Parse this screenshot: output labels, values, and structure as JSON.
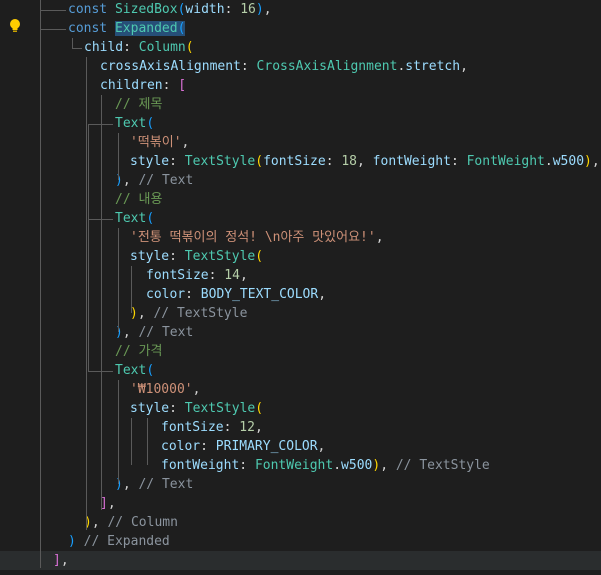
{
  "editor": {
    "lines": [
      {
        "segments": [
          {
            "t": "const",
            "c": "kw"
          },
          {
            "t": " "
          },
          {
            "t": "SizedBox",
            "c": "cls"
          },
          {
            "t": "(",
            "c": "b3"
          },
          {
            "t": "width",
            "c": "prop"
          },
          {
            "t": ": "
          },
          {
            "t": "16",
            "c": "num"
          },
          {
            "t": ")",
            "c": "b3"
          },
          {
            "t": ","
          }
        ]
      },
      {
        "segments": [
          {
            "t": "const",
            "c": "kw"
          },
          {
            "t": " "
          },
          {
            "t": "Expanded",
            "c": "cls hl"
          },
          {
            "t": "(",
            "c": "b3 hl"
          }
        ]
      },
      {
        "segments": [
          {
            "t": "child",
            "c": "prop"
          },
          {
            "t": ": "
          },
          {
            "t": "Column",
            "c": "cls"
          },
          {
            "t": "(",
            "c": "b1"
          }
        ]
      },
      {
        "segments": [
          {
            "t": "crossAxisAlignment",
            "c": "prop"
          },
          {
            "t": ": "
          },
          {
            "t": "CrossAxisAlignment",
            "c": "cls"
          },
          {
            "t": "."
          },
          {
            "t": "stretch",
            "c": "prop"
          },
          {
            "t": ","
          }
        ]
      },
      {
        "segments": [
          {
            "t": "children",
            "c": "prop"
          },
          {
            "t": ": "
          },
          {
            "t": "[",
            "c": "b2"
          }
        ]
      },
      {
        "segments": [
          {
            "t": "// 제목",
            "c": "cmt"
          }
        ]
      },
      {
        "segments": [
          {
            "t": "Text",
            "c": "cls"
          },
          {
            "t": "(",
            "c": "b3"
          }
        ]
      },
      {
        "segments": [
          {
            "t": "'떡볶이'",
            "c": "str"
          },
          {
            "t": ","
          }
        ]
      },
      {
        "segments": [
          {
            "t": "style",
            "c": "prop"
          },
          {
            "t": ": "
          },
          {
            "t": "TextStyle",
            "c": "cls"
          },
          {
            "t": "(",
            "c": "b1"
          },
          {
            "t": "fontSize",
            "c": "prop"
          },
          {
            "t": ": "
          },
          {
            "t": "18",
            "c": "num"
          },
          {
            "t": ", "
          },
          {
            "t": "fontWeight",
            "c": "prop"
          },
          {
            "t": ": "
          },
          {
            "t": "FontWeight",
            "c": "cls"
          },
          {
            "t": "."
          },
          {
            "t": "w500",
            "c": "prop"
          },
          {
            "t": ")",
            "c": "b1"
          },
          {
            "t": ","
          }
        ]
      },
      {
        "segments": [
          {
            "t": ")",
            "c": "b3"
          },
          {
            "t": ", "
          },
          {
            "t": "// Text",
            "c": "hint"
          }
        ]
      },
      {
        "segments": [
          {
            "t": "// 내용",
            "c": "cmt"
          }
        ]
      },
      {
        "segments": [
          {
            "t": "Text",
            "c": "cls"
          },
          {
            "t": "(",
            "c": "b3"
          }
        ]
      },
      {
        "segments": [
          {
            "t": "'전통 떡볶이의 정석! \\n아주 맛있어요!'",
            "c": "str"
          },
          {
            "t": ","
          }
        ]
      },
      {
        "segments": [
          {
            "t": "style",
            "c": "prop"
          },
          {
            "t": ": "
          },
          {
            "t": "TextStyle",
            "c": "cls"
          },
          {
            "t": "(",
            "c": "b1"
          }
        ]
      },
      {
        "segments": [
          {
            "t": "fontSize",
            "c": "prop"
          },
          {
            "t": ": "
          },
          {
            "t": "14",
            "c": "num"
          },
          {
            "t": ","
          }
        ]
      },
      {
        "segments": [
          {
            "t": "color",
            "c": "prop"
          },
          {
            "t": ": "
          },
          {
            "t": "BODY_TEXT_COLOR",
            "c": "prop"
          },
          {
            "t": ","
          }
        ]
      },
      {
        "segments": [
          {
            "t": ")",
            "c": "b1"
          },
          {
            "t": ", "
          },
          {
            "t": "// TextStyle",
            "c": "hint"
          }
        ]
      },
      {
        "segments": [
          {
            "t": ")",
            "c": "b3"
          },
          {
            "t": ", "
          },
          {
            "t": "// Text",
            "c": "hint"
          }
        ]
      },
      {
        "segments": [
          {
            "t": "// 가격",
            "c": "cmt"
          }
        ]
      },
      {
        "segments": [
          {
            "t": "Text",
            "c": "cls"
          },
          {
            "t": "(",
            "c": "b3"
          }
        ]
      },
      {
        "segments": [
          {
            "t": "'₩10000'",
            "c": "str"
          },
          {
            "t": ","
          }
        ]
      },
      {
        "segments": [
          {
            "t": "style",
            "c": "prop"
          },
          {
            "t": ": "
          },
          {
            "t": "TextStyle",
            "c": "cls"
          },
          {
            "t": "(",
            "c": "b1"
          }
        ]
      },
      {
        "segments": [
          {
            "t": "fontSize",
            "c": "prop"
          },
          {
            "t": ": "
          },
          {
            "t": "12",
            "c": "num"
          },
          {
            "t": ","
          }
        ]
      },
      {
        "segments": [
          {
            "t": "color",
            "c": "prop"
          },
          {
            "t": ": "
          },
          {
            "t": "PRIMARY_COLOR",
            "c": "prop"
          },
          {
            "t": ","
          }
        ]
      },
      {
        "segments": [
          {
            "t": "fontWeight",
            "c": "prop"
          },
          {
            "t": ": "
          },
          {
            "t": "FontWeight",
            "c": "cls"
          },
          {
            "t": "."
          },
          {
            "t": "w500",
            "c": "prop"
          },
          {
            "t": ")",
            "c": "b1"
          },
          {
            "t": ", "
          },
          {
            "t": "// TextStyle",
            "c": "hint"
          }
        ]
      },
      {
        "segments": [
          {
            "t": ")",
            "c": "b3"
          },
          {
            "t": ", "
          },
          {
            "t": "// Text",
            "c": "hint"
          }
        ]
      },
      {
        "segments": [
          {
            "t": "]",
            "c": "b2"
          },
          {
            "t": ","
          }
        ]
      },
      {
        "segments": [
          {
            "t": ")",
            "c": "b1"
          },
          {
            "t": ", "
          },
          {
            "t": "// Column",
            "c": "hint"
          }
        ]
      },
      {
        "segments": [
          {
            "t": ")",
            "c": "b3"
          },
          {
            "t": " "
          },
          {
            "t": "// Expanded",
            "c": "hint"
          }
        ]
      },
      {
        "segments": [
          {
            "t": "]",
            "c": "b2"
          },
          {
            "t": ","
          }
        ]
      }
    ]
  },
  "lightbulb": {
    "icon": "lightbulb-icon",
    "color": "#ffcc00"
  }
}
